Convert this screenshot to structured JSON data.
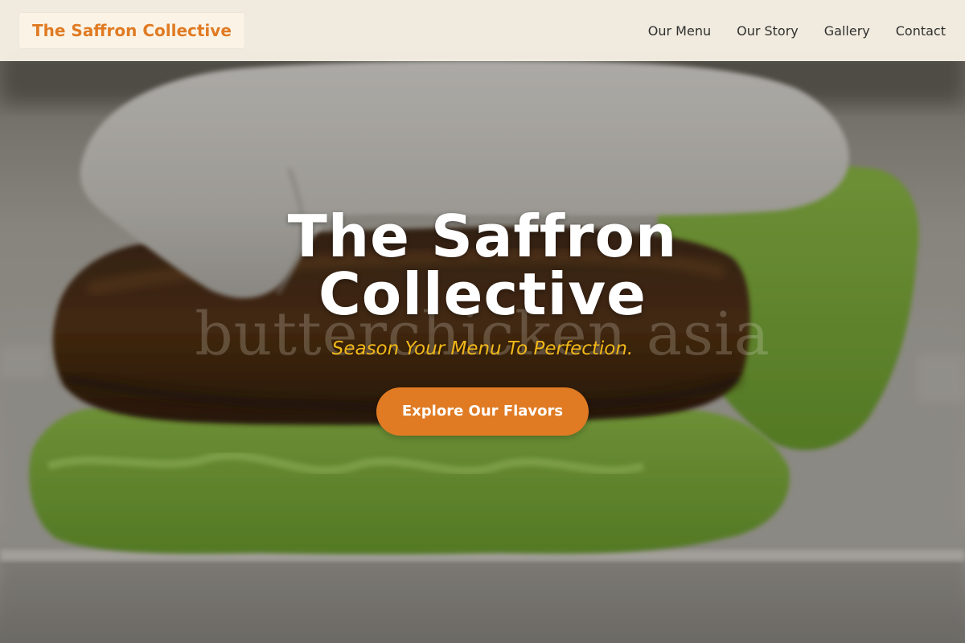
{
  "header": {
    "brand": "The Saffron Collective",
    "nav": [
      {
        "label": "Our Menu"
      },
      {
        "label": "Our Story"
      },
      {
        "label": "Gallery"
      },
      {
        "label": "Contact"
      }
    ]
  },
  "hero": {
    "title_line1": "The Saffron",
    "title_line2": "Collective",
    "watermark": "butterchicken asia",
    "tagline": "Season Your Menu To Perfection.",
    "cta_label": "Explore Our Flavors"
  },
  "colors": {
    "accent": "#e07b24",
    "tagline": "#f2b81a",
    "nav_bg": "#faf3e8",
    "nav_text": "#2f2f2f"
  }
}
